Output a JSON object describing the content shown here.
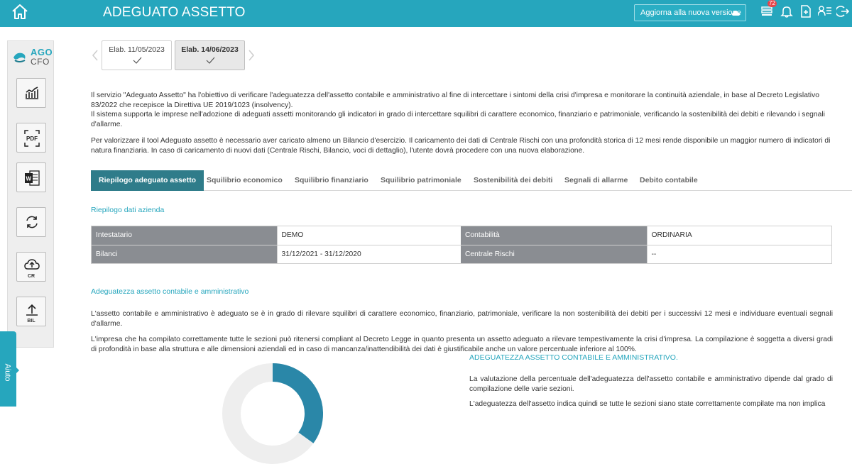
{
  "header": {
    "title": "ADEGUATO ASSETTO",
    "update_label": "Aggiorna alla nuova versione",
    "notifications_count": "72",
    "icons": [
      "home-icon",
      "cloud-icon",
      "list-icon",
      "bell-icon",
      "document-icon",
      "user-list-icon",
      "logout-icon"
    ]
  },
  "sidebar": {
    "logo_top": "AGO",
    "logo_bottom": "CFO",
    "buttons": [
      {
        "icon": "chart-icon",
        "label": ""
      },
      {
        "icon": "pdf-icon",
        "label": ""
      },
      {
        "icon": "word-icon",
        "label": ""
      },
      {
        "icon": "refresh-icon",
        "label": ""
      },
      {
        "icon": "cloud-upload-icon",
        "label": "CR"
      },
      {
        "icon": "upload-icon",
        "label": "BIL"
      }
    ]
  },
  "help_tab": "Aiuto",
  "elaborations": [
    {
      "label": "Elab. 11/05/2023",
      "active": false
    },
    {
      "label": "Elab. 14/06/2023",
      "active": true
    }
  ],
  "intro": {
    "p1": "Il servizio \"Adeguato Assetto\" ha l'obiettivo di verificare l'adeguatezza dell'assetto contabile e amministrativo al fine di intercettare i sintomi della crisi d'impresa e monitorare la continuità aziendale, in base al Decreto Legislativo 83/2022 che recepisce la Direttiva UE 2019/1023 (insolvency).",
    "p1b": "Il sistema supporta le imprese nell'adozione di adeguati assetti monitorando gli indicatori in grado di intercettare squilibri di carattere economico, finanziario e patrimoniale, verificando la sostenibilità dei debiti e rilevando i segnali d'allarme.",
    "p2": "Per valorizzare il tool Adeguato assetto è necessario aver caricato almeno un Bilancio d'esercizio. Il caricamento dei dati di Centrale Rischi con una profondità storica di 12 mesi rende disponibile un maggior numero di indicatori di natura finanziaria. In caso di caricamento di nuovi dati (Centrale Rischi, Bilancio, voci di dettaglio), l'utente dovrà procedere con una nuova elaborazione."
  },
  "tabs": [
    {
      "label": "Riepilogo adeguato assetto",
      "active": true
    },
    {
      "label": "Squilibrio economico",
      "active": false
    },
    {
      "label": "Squilibrio finanziario",
      "active": false
    },
    {
      "label": "Squilibrio patrimoniale",
      "active": false
    },
    {
      "label": "Sostenibilità dei debiti",
      "active": false
    },
    {
      "label": "Segnali di allarme",
      "active": false
    },
    {
      "label": "Debito contabile",
      "active": false
    }
  ],
  "company": {
    "section_title": "Riepilogo dati azienda",
    "rows": [
      {
        "k1": "Intestatario",
        "v1": "DEMO",
        "k2": "Contabilità",
        "v2": "ORDINARIA"
      },
      {
        "k1": "Bilanci",
        "v1": "31/12/2021 - 31/12/2020",
        "k2": "Centrale Rischi",
        "v2": "--"
      }
    ]
  },
  "adequacy": {
    "section_title": "Adeguatezza assetto contabile e amministrativo",
    "p1": "L'assetto contabile e amministrativo è adeguato se è in grado di rilevare squilibri di carattere economico, finanziario, patrimoniale, verificare la non sostenibilità dei debiti per i successivi 12 mesi e individuare eventuali segnali d'allarme.",
    "p2": "L'impresa che ha compilato correttamente tutte le sezioni può ritenersi compliant al Decreto Legge in quanto presenta un assetto adeguato a rilevare tempestivamente la crisi d'impresa. La compilazione è soggetta a diversi gradi di profondità in base alla struttura e alle dimensioni aziendali ed in caso di mancanza/inattendibilità dei dati è giustificabile anche un valore percentuale inferiore al 100%.",
    "right_title": "ADEGUATEZZA ASSETTO CONTABILE E AMMINISTRATIVO.",
    "right_p1": "La valutazione della percentuale dell'adeguatezza dell'assetto contabile e amministrativo dipende dal grado di compilazione delle varie sezioni.",
    "right_p2": "L'adeguatezza dell'assetto indica quindi se tutte le sezioni siano state correttamente compilate ma non implica",
    "donut_label": "",
    "donut_fraction": 0.35,
    "colors": {
      "accent": "#26a6bd",
      "donut_track": "#eeeeee",
      "donut_fill": "#2a87a8"
    }
  }
}
